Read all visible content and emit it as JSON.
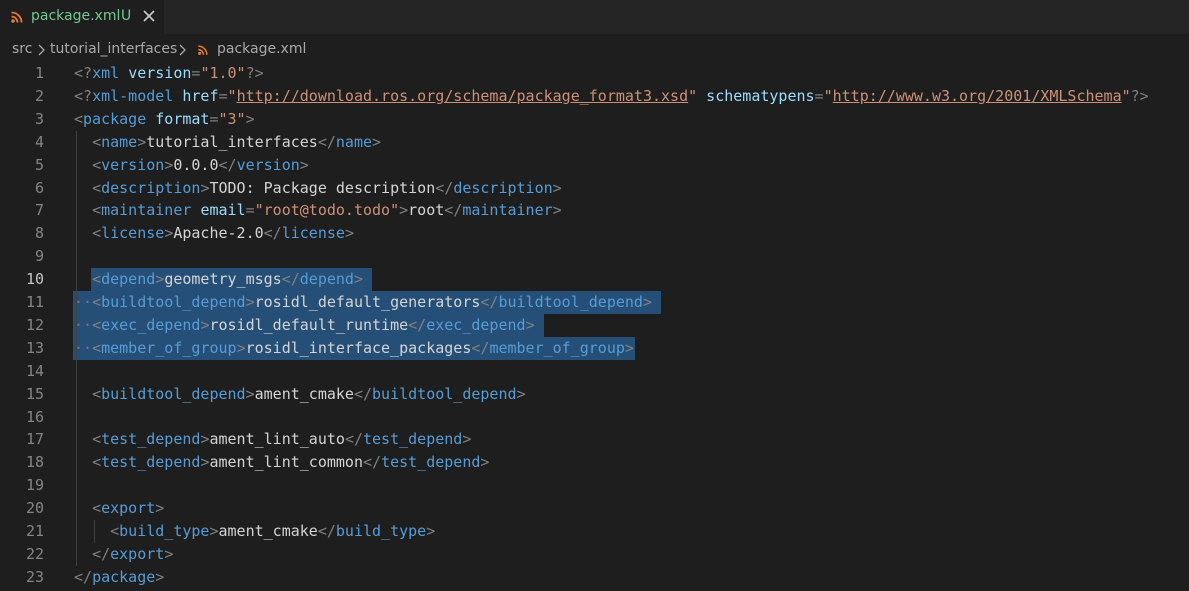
{
  "tab": {
    "label": "package.xml",
    "status": "U"
  },
  "breadcrumb": {
    "items": [
      "src",
      "tutorial_interfaces",
      "package.xml"
    ]
  },
  "editor": {
    "lines": [
      {
        "n": "1",
        "code": [
          [
            "p",
            "<?"
          ],
          [
            "tag",
            "xml"
          ],
          [
            "txt",
            " "
          ],
          [
            "attr",
            "version"
          ],
          [
            "p",
            "="
          ],
          [
            "str",
            "\"1.0\""
          ],
          [
            "p",
            "?>"
          ]
        ]
      },
      {
        "n": "2",
        "code": [
          [
            "p",
            "<?"
          ],
          [
            "tag",
            "xml-model"
          ],
          [
            "txt",
            " "
          ],
          [
            "attr",
            "href"
          ],
          [
            "p",
            "="
          ],
          [
            "str",
            "\""
          ],
          [
            "url",
            "http://download.ros.org/schema/package_format3.xsd"
          ],
          [
            "str",
            "\""
          ],
          [
            "txt",
            " "
          ],
          [
            "attr",
            "schematypens"
          ],
          [
            "p",
            "="
          ],
          [
            "str",
            "\""
          ],
          [
            "url",
            "http://www.w3.org/2001/XMLSchema"
          ],
          [
            "str",
            "\""
          ],
          [
            "p",
            "?>"
          ]
        ]
      },
      {
        "n": "3",
        "code": [
          [
            "p",
            "<"
          ],
          [
            "tag",
            "package"
          ],
          [
            "txt",
            " "
          ],
          [
            "attr",
            "format"
          ],
          [
            "p",
            "="
          ],
          [
            "str",
            "\"3\""
          ],
          [
            "p",
            ">"
          ]
        ]
      },
      {
        "n": "4",
        "code": [
          [
            "txt",
            "  "
          ],
          [
            "p",
            "<"
          ],
          [
            "tag",
            "name"
          ],
          [
            "p",
            ">"
          ],
          [
            "txt",
            "tutorial_interfaces"
          ],
          [
            "p",
            "</"
          ],
          [
            "tag",
            "name"
          ],
          [
            "p",
            ">"
          ]
        ]
      },
      {
        "n": "5",
        "code": [
          [
            "txt",
            "  "
          ],
          [
            "p",
            "<"
          ],
          [
            "tag",
            "version"
          ],
          [
            "p",
            ">"
          ],
          [
            "txt",
            "0.0.0"
          ],
          [
            "p",
            "</"
          ],
          [
            "tag",
            "version"
          ],
          [
            "p",
            ">"
          ]
        ]
      },
      {
        "n": "6",
        "code": [
          [
            "txt",
            "  "
          ],
          [
            "p",
            "<"
          ],
          [
            "tag",
            "description"
          ],
          [
            "p",
            ">"
          ],
          [
            "txt",
            "TODO: Package description"
          ],
          [
            "p",
            "</"
          ],
          [
            "tag",
            "description"
          ],
          [
            "p",
            ">"
          ]
        ]
      },
      {
        "n": "7",
        "code": [
          [
            "txt",
            "  "
          ],
          [
            "p",
            "<"
          ],
          [
            "tag",
            "maintainer"
          ],
          [
            "txt",
            " "
          ],
          [
            "attr",
            "email"
          ],
          [
            "p",
            "="
          ],
          [
            "str",
            "\"root@todo.todo\""
          ],
          [
            "p",
            ">"
          ],
          [
            "txt",
            "root"
          ],
          [
            "p",
            "</"
          ],
          [
            "tag",
            "maintainer"
          ],
          [
            "p",
            ">"
          ]
        ]
      },
      {
        "n": "8",
        "code": [
          [
            "txt",
            "  "
          ],
          [
            "p",
            "<"
          ],
          [
            "tag",
            "license"
          ],
          [
            "p",
            ">"
          ],
          [
            "txt",
            "Apache-2.0"
          ],
          [
            "p",
            "</"
          ],
          [
            "tag",
            "license"
          ],
          [
            "p",
            ">"
          ]
        ]
      },
      {
        "n": "9",
        "code": []
      },
      {
        "n": "10",
        "code": [
          [
            "txt",
            "  "
          ],
          [
            "p",
            "<"
          ],
          [
            "tag",
            "depend"
          ],
          [
            "p",
            ">"
          ],
          [
            "txt",
            "geometry_msgs"
          ],
          [
            "p",
            "</"
          ],
          [
            "tag",
            "depend"
          ],
          [
            "p",
            ">"
          ]
        ]
      },
      {
        "n": "11",
        "code": [
          [
            "ws",
            "··"
          ],
          [
            "p",
            "<"
          ],
          [
            "tag",
            "buildtool_depend"
          ],
          [
            "p",
            ">"
          ],
          [
            "txt",
            "rosidl_default_generators"
          ],
          [
            "p",
            "</"
          ],
          [
            "tag",
            "buildtool_depend"
          ],
          [
            "p",
            ">"
          ]
        ]
      },
      {
        "n": "12",
        "code": [
          [
            "ws",
            "··"
          ],
          [
            "p",
            "<"
          ],
          [
            "tag",
            "exec_depend"
          ],
          [
            "p",
            ">"
          ],
          [
            "txt",
            "rosidl_default_runtime"
          ],
          [
            "p",
            "</"
          ],
          [
            "tag",
            "exec_depend"
          ],
          [
            "p",
            ">"
          ]
        ]
      },
      {
        "n": "13",
        "code": [
          [
            "ws",
            "··"
          ],
          [
            "p",
            "<"
          ],
          [
            "tag",
            "member_of_group"
          ],
          [
            "p",
            ">"
          ],
          [
            "txt",
            "rosidl_interface_packages"
          ],
          [
            "p",
            "</"
          ],
          [
            "tag",
            "member_of_group"
          ],
          [
            "p",
            ">"
          ]
        ]
      },
      {
        "n": "14",
        "code": []
      },
      {
        "n": "15",
        "code": [
          [
            "txt",
            "  "
          ],
          [
            "p",
            "<"
          ],
          [
            "tag",
            "buildtool_depend"
          ],
          [
            "p",
            ">"
          ],
          [
            "txt",
            "ament_cmake"
          ],
          [
            "p",
            "</"
          ],
          [
            "tag",
            "buildtool_depend"
          ],
          [
            "p",
            ">"
          ]
        ]
      },
      {
        "n": "16",
        "code": []
      },
      {
        "n": "17",
        "code": [
          [
            "txt",
            "  "
          ],
          [
            "p",
            "<"
          ],
          [
            "tag",
            "test_depend"
          ],
          [
            "p",
            ">"
          ],
          [
            "txt",
            "ament_lint_auto"
          ],
          [
            "p",
            "</"
          ],
          [
            "tag",
            "test_depend"
          ],
          [
            "p",
            ">"
          ]
        ]
      },
      {
        "n": "18",
        "code": [
          [
            "txt",
            "  "
          ],
          [
            "p",
            "<"
          ],
          [
            "tag",
            "test_depend"
          ],
          [
            "p",
            ">"
          ],
          [
            "txt",
            "ament_lint_common"
          ],
          [
            "p",
            "</"
          ],
          [
            "tag",
            "test_depend"
          ],
          [
            "p",
            ">"
          ]
        ]
      },
      {
        "n": "19",
        "code": []
      },
      {
        "n": "20",
        "code": [
          [
            "txt",
            "  "
          ],
          [
            "p",
            "<"
          ],
          [
            "tag",
            "export"
          ],
          [
            "p",
            ">"
          ]
        ]
      },
      {
        "n": "21",
        "code": [
          [
            "txt",
            "    "
          ],
          [
            "p",
            "<"
          ],
          [
            "tag",
            "build_type"
          ],
          [
            "p",
            ">"
          ],
          [
            "txt",
            "ament_cmake"
          ],
          [
            "p",
            "</"
          ],
          [
            "tag",
            "build_type"
          ],
          [
            "p",
            ">"
          ]
        ]
      },
      {
        "n": "22",
        "code": [
          [
            "txt",
            "  "
          ],
          [
            "p",
            "</"
          ],
          [
            "tag",
            "export"
          ],
          [
            "p",
            ">"
          ]
        ]
      },
      {
        "n": "23",
        "code": [
          [
            "p",
            "</"
          ],
          [
            "tag",
            "package"
          ],
          [
            "p",
            ">"
          ]
        ]
      }
    ]
  },
  "colors": {
    "background": "#1e1e1e",
    "tabbar": "#252526",
    "selection": "#264f78",
    "untracked": "#73c991",
    "tag": "#569cd6",
    "attribute": "#9cdcfe",
    "string": "#ce9178",
    "punctuation": "#808080",
    "rss_icon": "#e37933"
  },
  "icons": {
    "file_type": "rss-icon",
    "close": "close-icon",
    "separator": "chevron-right-icon"
  }
}
